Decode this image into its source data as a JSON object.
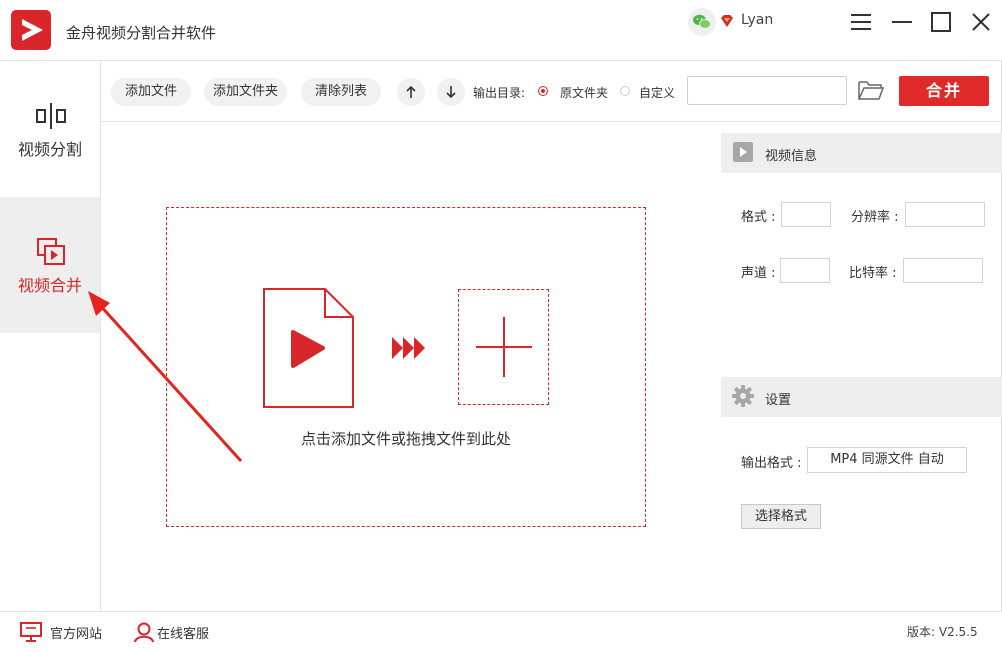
{
  "window": {
    "title": "金舟视频分割合并软件"
  },
  "user": {
    "name": "Lyan"
  },
  "icons": {
    "app_logo": "app-logo-icon",
    "wechat": "wechat-icon",
    "vip": "vip-diamond-icon",
    "menu": "hamburger-menu-icon",
    "minimize": "minimize-icon",
    "maximize": "maximize-icon",
    "close": "close-icon",
    "split": "video-split-icon",
    "merge": "video-merge-icon",
    "up": "arrow-up-icon",
    "down": "arrow-down-icon",
    "folder": "folder-open-icon",
    "file": "video-file-icon",
    "forward": "triple-chevron-icon",
    "plus": "plus-icon",
    "video_info": "video-icon",
    "settings": "gear-icon",
    "site": "monitor-icon",
    "service": "user-icon"
  },
  "sidebar": {
    "items": [
      {
        "label": "视频分割",
        "active": false
      },
      {
        "label": "视频合并",
        "active": true
      }
    ]
  },
  "toolbar": {
    "add_file": "添加文件",
    "add_folder": "添加文件夹",
    "clear_list": "清除列表",
    "output_dir_label": "输出目录:",
    "radio_source": "原文件夹",
    "radio_custom": "自定义",
    "selected_radio": "原文件夹",
    "path_value": "",
    "merge": "合并"
  },
  "dropzone": {
    "hint": "点击添加文件或拖拽文件到此处"
  },
  "video_info": {
    "title": "视频信息",
    "format_label": "格式 :",
    "format_value": "",
    "resolution_label": "分辨率 :",
    "resolution_value": "",
    "channel_label": "声道 :",
    "channel_value": "",
    "bitrate_label": "比特率 :",
    "bitrate_value": ""
  },
  "settings": {
    "title": "设置",
    "output_format_label": "输出格式 :",
    "output_format_value": "MP4 同源文件 自动",
    "choose_format": "选择格式"
  },
  "footer": {
    "site": "官方网站",
    "service": "在线客服",
    "version": "版本: V2.5.5"
  },
  "colors": {
    "brand_red": "#d9262b",
    "merge_button": "#e02a2a",
    "sidebar_active_bg": "#eeeeee",
    "panel_header_bg": "#eeeeee"
  }
}
